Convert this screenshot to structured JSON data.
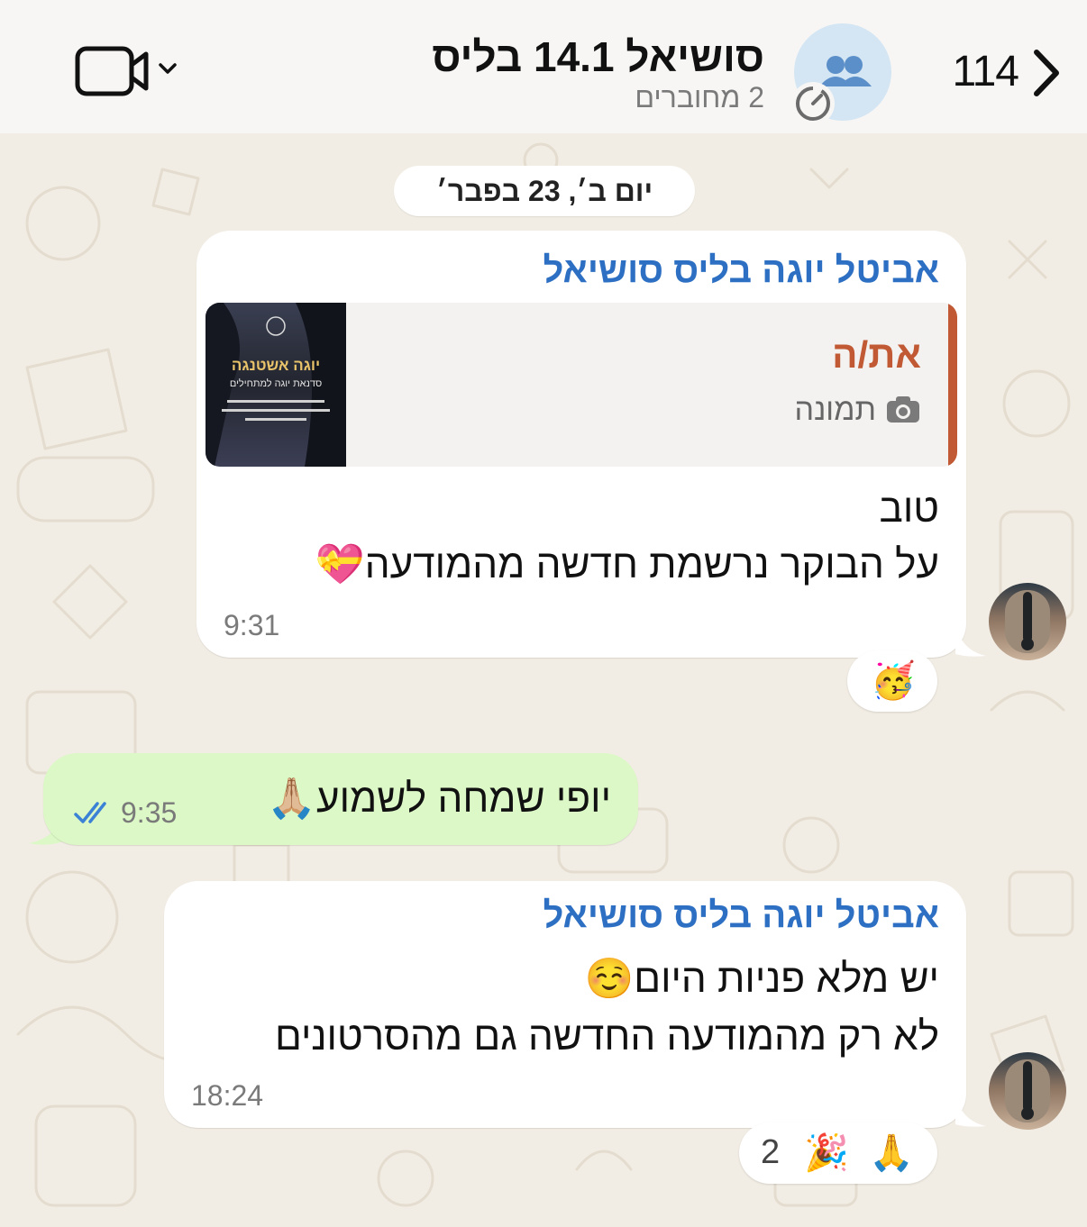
{
  "header": {
    "unread_count": "114",
    "title": "סושיאל 14.1 בליס",
    "subtitle": "2 מחוברים",
    "icons": {
      "back": "chevron-left-icon",
      "group": "group-icon",
      "timer": "disappearing-timer-icon",
      "video": "video-call-icon",
      "dropdown": "chevron-down-icon"
    }
  },
  "date_separator": "יום ב׳, 23 בפבר׳",
  "messages": [
    {
      "direction": "incoming",
      "sender": "אביטל יוגה בליס סושיאל",
      "reply": {
        "name": "את/ה",
        "kind": "תמונה",
        "thumb_title": "יוגה אשטנגה",
        "thumb_subtitle": "סדנאת יוגה למתחילים"
      },
      "lines": [
        "טוב",
        "על הבוקר נרשמת חדשה מהמודעה💝"
      ],
      "time": "9:31",
      "reactions": {
        "emojis": [
          "🥳"
        ],
        "count": ""
      }
    },
    {
      "direction": "outgoing",
      "lines": [
        "יופי שמחה לשמוע🙏🏼"
      ],
      "time": "9:35",
      "status": "read"
    },
    {
      "direction": "incoming",
      "sender": "אביטל יוגה בליס סושיאל",
      "lines": [
        "יש מלא פניות היום☺️",
        "לא רק מהמודעה החדשה גם מהסרטונים"
      ],
      "time": "18:24",
      "reactions": {
        "emojis": [
          "🙏",
          "🎉"
        ],
        "count": "2"
      }
    }
  ],
  "colors": {
    "header_bg": "#f7f6f4",
    "wallpaper": "#f2ede4",
    "sender_name": "#2d6fc2",
    "reply_accent": "#c15a34",
    "outgoing_bubble": "#dbf8c6",
    "read_ticks": "#3b82d6"
  }
}
